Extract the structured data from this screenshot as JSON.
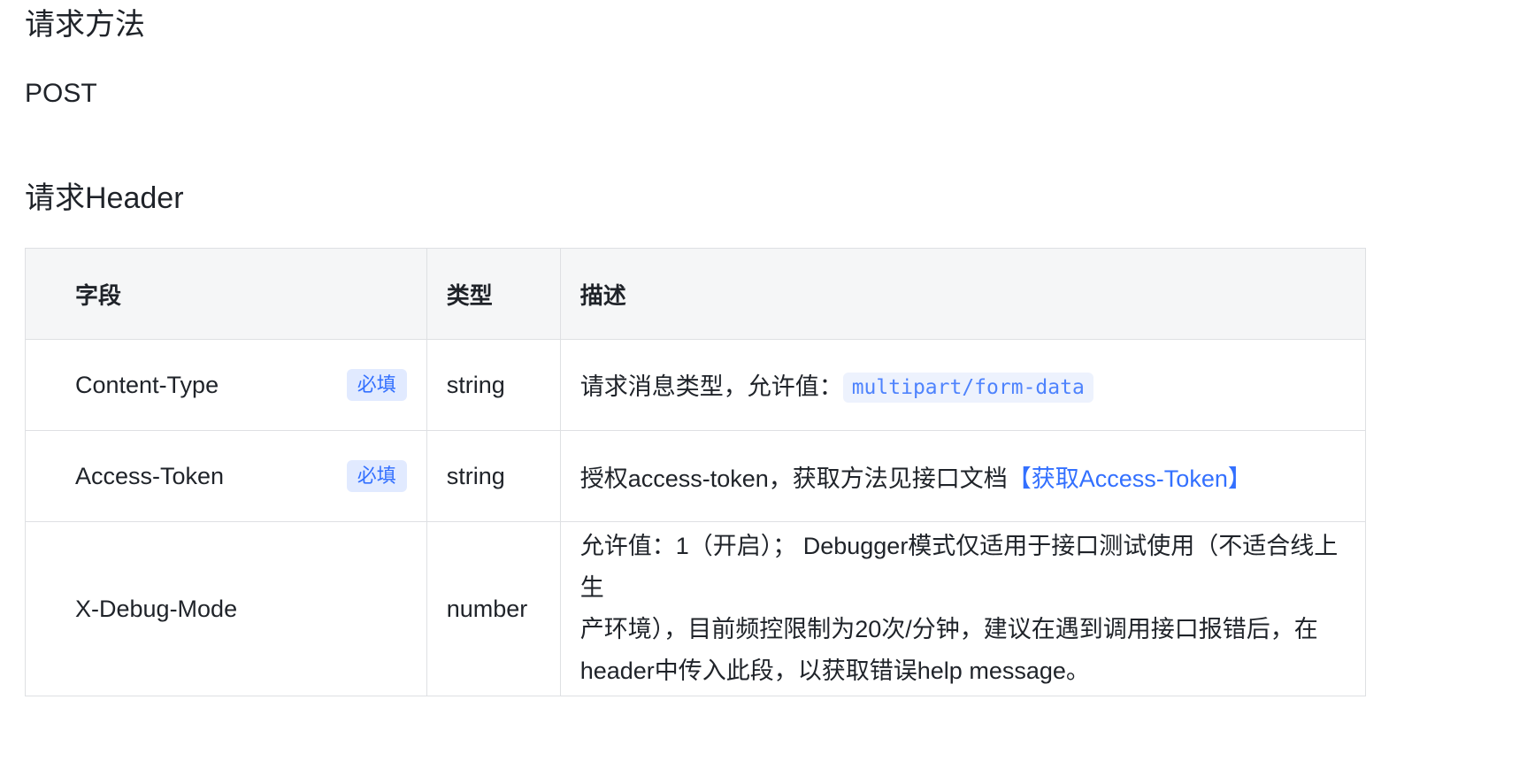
{
  "method_section": {
    "title": "请求方法",
    "value": "POST"
  },
  "header_section": {
    "title": "请求Header",
    "table": {
      "headers": [
        "字段",
        "类型",
        "描述"
      ],
      "rows": [
        {
          "field": "Content-Type",
          "required_badge": "必填",
          "type": "string",
          "desc_prefix": "请求消息类型，允许值：",
          "desc_code": "multipart/form-data"
        },
        {
          "field": "Access-Token",
          "required_badge": "必填",
          "type": "string",
          "desc_prefix": "授权access-token，获取方法见接口文档",
          "desc_link": "【获取Access-Token】"
        },
        {
          "field": "X-Debug-Mode",
          "type": "number",
          "desc_line1": "允许值：1（开启）； Debugger模式仅适用于接口测试使用（不适合线上生",
          "desc_line2": "产环境），目前频控限制为20次/分钟，建议在遇到调用接口报错后，在",
          "desc_line3": "header中传入此段，以获取错误help message。"
        }
      ]
    }
  },
  "colors": {
    "text": "#1f2329",
    "header_bg": "#f5f6f7",
    "border": "#dee0e3",
    "badge_bg": "#e1eaff",
    "badge_text": "#3370ff",
    "link": "#3370ff",
    "code_bg": "#edf2fd",
    "code_text": "#4e83fd"
  }
}
